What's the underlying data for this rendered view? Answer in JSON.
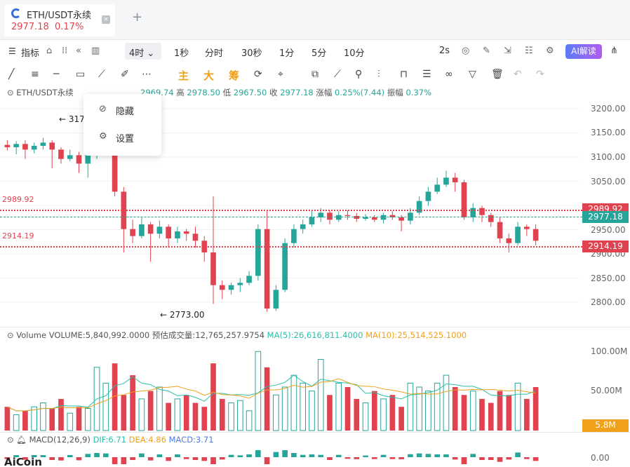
{
  "tab": {
    "title": "ETH/USDT永续",
    "price": "2977.18",
    "change": "0.17%",
    "close_label": "×",
    "add_label": "+"
  },
  "toolbar": {
    "indicator_label": "指标",
    "interval_active": "4时",
    "intervals": [
      "1秒",
      "分时",
      "30秒",
      "1分",
      "5分",
      "10分"
    ],
    "refresh": "2s",
    "ai_label": "AI解读"
  },
  "draw_tools": {
    "main": "主",
    "big": "大",
    "chip": "筹"
  },
  "info": {
    "symbol": "ETH/USDT永续",
    "open_val": "2969.74",
    "high_label": "高",
    "high_val": "2978.50",
    "low_label": "低",
    "low_val": "2967.50",
    "close_label": "收",
    "close_val": "2977.18",
    "chg_label": "涨幅",
    "chg_val": "0.25%(7.44)",
    "amp_label": "振幅",
    "amp_val": "0.37%"
  },
  "menu": {
    "hide": "隐藏",
    "settings": "设置"
  },
  "price_axis": [
    "3200.00",
    "3150.00",
    "3100.00",
    "3050.00",
    "2950.00",
    "2900.00",
    "2850.00",
    "2800.00"
  ],
  "levels": {
    "upper_left": "2989.92",
    "lower_left": "2914.19",
    "upper_tag": "2989.92",
    "current_tag": "2977.18",
    "lower_tag": "2914.19",
    "high_mark": "3177",
    "low_mark": "2773.00"
  },
  "volume": {
    "label": "Volume",
    "vol_text": "VOLUME:5,840,992.0000",
    "est_text": "预估成交量:12,765,257.9754",
    "ma5_text": "MA(5):26,616,811.4000",
    "ma10_text": "MA(10):25,514,525.1000",
    "axis": [
      "100.00M",
      "50.00M"
    ],
    "current_tag": "5.8M"
  },
  "macd": {
    "label": "MACD(12,26,9)",
    "dif": "DIF:6.71",
    "dea": "DEA:4.86",
    "macd": "MACD:3.71",
    "axis": "0.00"
  },
  "watermark": "AiCoin",
  "colors": {
    "up": "#26a69a",
    "down": "#e0434f",
    "ma5": "#2bbfa9",
    "ma10": "#f0a11c",
    "accent": "#5b7cf7"
  },
  "chart_data": {
    "type": "candlestick",
    "ylim": [
      2750,
      3230
    ],
    "candles": [
      [
        3130,
        3125,
        3140,
        3118
      ],
      [
        3125,
        3132,
        3138,
        3110
      ],
      [
        3132,
        3120,
        3140,
        3100
      ],
      [
        3120,
        3128,
        3135,
        3112
      ],
      [
        3128,
        3135,
        3145,
        3120
      ],
      [
        3135,
        3120,
        3140,
        3080
      ],
      [
        3120,
        3100,
        3125,
        3090
      ],
      [
        3100,
        3108,
        3120,
        3095
      ],
      [
        3108,
        3090,
        3115,
        3070
      ],
      [
        3090,
        3110,
        3118,
        3060
      ],
      [
        3110,
        3140,
        3148,
        3100
      ],
      [
        3140,
        3165,
        3177,
        3130
      ],
      [
        3165,
        3030,
        3170,
        3020
      ],
      [
        3030,
        2950,
        3040,
        2900
      ],
      [
        2950,
        2935,
        2970,
        2920
      ],
      [
        2935,
        2960,
        2975,
        2930
      ],
      [
        2960,
        2940,
        2965,
        2880
      ],
      [
        2940,
        2955,
        2968,
        2930
      ],
      [
        2955,
        2930,
        2960,
        2910
      ],
      [
        2930,
        2945,
        2955,
        2920
      ],
      [
        2945,
        2940,
        2950,
        2925
      ],
      [
        2940,
        2925,
        2955,
        2910
      ],
      [
        2925,
        2900,
        2935,
        2880
      ],
      [
        2900,
        2830,
        3020,
        2790
      ],
      [
        2830,
        2820,
        2840,
        2800
      ],
      [
        2820,
        2830,
        2835,
        2810
      ],
      [
        2830,
        2835,
        2845,
        2815
      ],
      [
        2835,
        2850,
        2860,
        2830
      ],
      [
        2850,
        2950,
        2960,
        2840
      ],
      [
        2950,
        2780,
        2990,
        2773
      ],
      [
        2780,
        2820,
        2830,
        2775
      ],
      [
        2820,
        2920,
        2930,
        2815
      ],
      [
        2920,
        2950,
        2960,
        2910
      ],
      [
        2950,
        2960,
        2970,
        2940
      ],
      [
        2960,
        2975,
        2990,
        2955
      ],
      [
        2975,
        2985,
        2995,
        2965
      ],
      [
        2985,
        2970,
        2990,
        2960
      ],
      [
        2970,
        2980,
        2988,
        2965
      ],
      [
        2980,
        2978,
        2990,
        2970
      ],
      [
        2978,
        2972,
        2985,
        2965
      ],
      [
        2972,
        2975,
        2982,
        2968
      ],
      [
        2975,
        2970,
        2980,
        2965
      ],
      [
        2970,
        2980,
        2985,
        2962
      ],
      [
        2980,
        2975,
        2988,
        2970
      ],
      [
        2975,
        2968,
        2980,
        2945
      ],
      [
        2968,
        2985,
        2995,
        2960
      ],
      [
        2985,
        3010,
        3020,
        2980
      ],
      [
        3010,
        3030,
        3040,
        3000
      ],
      [
        3030,
        3045,
        3060,
        3025
      ],
      [
        3045,
        3060,
        3075,
        3040
      ],
      [
        3060,
        3050,
        3070,
        3030
      ],
      [
        3050,
        2975,
        3055,
        2970
      ],
      [
        2975,
        2995,
        3005,
        2965
      ],
      [
        2995,
        2980,
        3000,
        2965
      ],
      [
        2980,
        2965,
        2985,
        2955
      ],
      [
        2965,
        2930,
        2975,
        2920
      ],
      [
        2930,
        2920,
        2940,
        2900
      ],
      [
        2920,
        2955,
        2965,
        2915
      ],
      [
        2955,
        2950,
        2960,
        2935
      ],
      [
        2950,
        2925,
        2960,
        2915
      ]
    ],
    "volumes": [
      30,
      20,
      25,
      30,
      35,
      28,
      40,
      22,
      30,
      28,
      80,
      60,
      85,
      45,
      70,
      40,
      50,
      55,
      35,
      40,
      45,
      35,
      30,
      85,
      40,
      35,
      38,
      25,
      100,
      80,
      45,
      55,
      70,
      60,
      50,
      90,
      45,
      60,
      55,
      40,
      35,
      50,
      40,
      45,
      30,
      60,
      55,
      50,
      60,
      70,
      55,
      45,
      50,
      40,
      35,
      50,
      45,
      60,
      40,
      55
    ]
  }
}
